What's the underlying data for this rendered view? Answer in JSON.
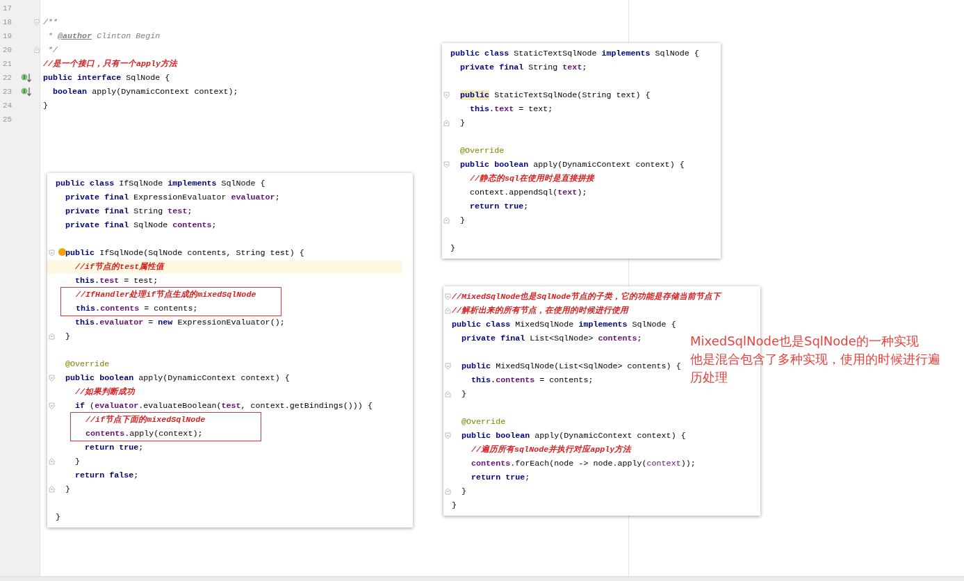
{
  "editor": {
    "lines": [
      {
        "number": "17",
        "kind": "blank",
        "gutter_icon": false
      },
      {
        "number": "18",
        "kind": "code",
        "gutter_icon": false,
        "fold_start": true,
        "tokens": [
          {
            "kind": "doc",
            "text": "/**"
          }
        ]
      },
      {
        "number": "19",
        "kind": "code",
        "gutter_icon": false,
        "tokens": [
          {
            "kind": "doc",
            "text": " * "
          },
          {
            "kind": "doctag",
            "text": "@author"
          },
          {
            "kind": "doc",
            "text": " Clinton Begin"
          }
        ]
      },
      {
        "number": "20",
        "kind": "code",
        "gutter_icon": false,
        "fold_end": true,
        "tokens": [
          {
            "kind": "doc",
            "text": " */"
          }
        ]
      },
      {
        "number": "21",
        "kind": "code",
        "gutter_icon": false,
        "tokens": [
          {
            "kind": "comment",
            "text": "//是一个接口，只有一个apply方法"
          }
        ]
      },
      {
        "number": "22",
        "kind": "code",
        "gutter_icon": true,
        "tokens": [
          {
            "kind": "keyword",
            "text": "public interface "
          },
          {
            "kind": "plain",
            "text": "SqlNode {"
          }
        ]
      },
      {
        "number": "23",
        "kind": "code",
        "gutter_icon": true,
        "tokens": [
          {
            "kind": "keyword",
            "text": "  boolean "
          },
          {
            "kind": "plain",
            "text": "apply(DynamicContext context);"
          }
        ]
      },
      {
        "number": "24",
        "kind": "code",
        "gutter_icon": false,
        "tokens": [
          {
            "kind": "plain",
            "text": "}"
          }
        ]
      },
      {
        "number": "25",
        "kind": "blank",
        "gutter_icon": false
      }
    ]
  },
  "panels": [
    {
      "lines": [
        {
          "kind": "code",
          "tokens": [
            {
              "kind": "keyword",
              "text": "public class "
            },
            {
              "kind": "plain",
              "text": "IfSqlNode "
            },
            {
              "kind": "keyword",
              "text": "implements "
            },
            {
              "kind": "plain",
              "text": "SqlNode {"
            }
          ]
        },
        {
          "kind": "code",
          "tokens": [
            {
              "kind": "keyword",
              "text": "  private final "
            },
            {
              "kind": "plain",
              "text": "ExpressionEvaluator "
            },
            {
              "kind": "field",
              "text": "evaluator"
            },
            {
              "kind": "plain",
              "text": ";"
            }
          ]
        },
        {
          "kind": "code",
          "tokens": [
            {
              "kind": "keyword",
              "text": "  private final "
            },
            {
              "kind": "plain",
              "text": "String "
            },
            {
              "kind": "field",
              "text": "test"
            },
            {
              "kind": "plain",
              "text": ";"
            }
          ]
        },
        {
          "kind": "code",
          "tokens": [
            {
              "kind": "keyword",
              "text": "  private final "
            },
            {
              "kind": "plain",
              "text": "SqlNode "
            },
            {
              "kind": "field",
              "text": "contents"
            },
            {
              "kind": "plain",
              "text": ";"
            }
          ]
        },
        {
          "kind": "blank"
        },
        {
          "kind": "code",
          "fold_start": true,
          "bulb": true,
          "tokens": [
            {
              "kind": "keyword",
              "text": "  public "
            },
            {
              "kind": "plain",
              "text": "IfSqlNode(SqlNode contents, String test) {"
            }
          ]
        },
        {
          "kind": "code",
          "highlighted": true,
          "tokens": [
            {
              "kind": "comment",
              "text": "    //if节点的test属性值"
            }
          ]
        },
        {
          "kind": "code",
          "tokens": [
            {
              "kind": "keyword",
              "text": "    this."
            },
            {
              "kind": "field",
              "text": "test"
            },
            {
              "kind": "plain",
              "text": " = test;"
            }
          ]
        },
        {
          "kind": "box",
          "lines": [
            {
              "kind": "code",
              "tokens": [
                {
                  "kind": "comment",
                  "text": "    //IfHandler处理if节点生成的mixedSqlNode"
                }
              ]
            },
            {
              "kind": "code",
              "tokens": [
                {
                  "kind": "keyword",
                  "text": "    this."
                },
                {
                  "kind": "field",
                  "text": "contents"
                },
                {
                  "kind": "plain",
                  "text": " = contents;"
                }
              ]
            }
          ]
        },
        {
          "kind": "code",
          "tokens": [
            {
              "kind": "keyword",
              "text": "    this."
            },
            {
              "kind": "field",
              "text": "evaluator"
            },
            {
              "kind": "plain",
              "text": " = "
            },
            {
              "kind": "keyword",
              "text": "new "
            },
            {
              "kind": "plain",
              "text": "ExpressionEvaluator();"
            }
          ]
        },
        {
          "kind": "code",
          "fold_end": true,
          "tokens": [
            {
              "kind": "plain",
              "text": "  }"
            }
          ]
        },
        {
          "kind": "blank"
        },
        {
          "kind": "code",
          "tokens": [
            {
              "kind": "annotation",
              "text": "  @Override"
            }
          ]
        },
        {
          "kind": "code",
          "fold_start": true,
          "tokens": [
            {
              "kind": "keyword",
              "text": "  public boolean "
            },
            {
              "kind": "plain",
              "text": "apply(DynamicContext context) {"
            }
          ]
        },
        {
          "kind": "code",
          "tokens": [
            {
              "kind": "comment",
              "text": "    //如果判断成功"
            }
          ]
        },
        {
          "kind": "code",
          "fold_start": true,
          "tokens": [
            {
              "kind": "keyword",
              "text": "    if "
            },
            {
              "kind": "plain",
              "text": "("
            },
            {
              "kind": "field",
              "text": "evaluator"
            },
            {
              "kind": "plain",
              "text": ".evaluateBoolean("
            },
            {
              "kind": "field",
              "text": "test"
            },
            {
              "kind": "plain",
              "text": ", context.getBindings())) {"
            }
          ]
        },
        {
          "kind": "box",
          "lines": [
            {
              "kind": "code",
              "tokens": [
                {
                  "kind": "comment",
                  "text": "      //if节点下面的mixedSqlNode"
                }
              ]
            },
            {
              "kind": "code",
              "tokens": [
                {
                  "kind": "field",
                  "text": "      contents"
                },
                {
                  "kind": "plain",
                  "text": ".apply(context);"
                }
              ]
            }
          ]
        },
        {
          "kind": "code",
          "tokens": [
            {
              "kind": "keyword",
              "text": "      return true"
            },
            {
              "kind": "plain",
              "text": ";"
            }
          ]
        },
        {
          "kind": "code",
          "fold_end": true,
          "tokens": [
            {
              "kind": "plain",
              "text": "    }"
            }
          ]
        },
        {
          "kind": "code",
          "tokens": [
            {
              "kind": "keyword",
              "text": "    return false"
            },
            {
              "kind": "plain",
              "text": ";"
            }
          ]
        },
        {
          "kind": "code",
          "fold_end": true,
          "tokens": [
            {
              "kind": "plain",
              "text": "  }"
            }
          ]
        },
        {
          "kind": "blank"
        },
        {
          "kind": "code",
          "tokens": [
            {
              "kind": "plain",
              "text": "}"
            }
          ]
        }
      ]
    },
    {
      "lines": [
        {
          "kind": "code",
          "tokens": [
            {
              "kind": "keyword",
              "text": "public class "
            },
            {
              "kind": "plain",
              "text": "StaticTextSqlNode "
            },
            {
              "kind": "keyword",
              "text": "implements "
            },
            {
              "kind": "plain",
              "text": "SqlNode {"
            }
          ]
        },
        {
          "kind": "code",
          "tokens": [
            {
              "kind": "keyword",
              "text": "  private final "
            },
            {
              "kind": "plain",
              "text": "String "
            },
            {
              "kind": "field",
              "text": "text"
            },
            {
              "kind": "plain",
              "text": ";"
            }
          ]
        },
        {
          "kind": "blank"
        },
        {
          "kind": "code",
          "fold_start": true,
          "tokens": [
            {
              "kind": "keyword_marked",
              "text": "  public"
            },
            {
              "kind": "plain",
              "text": " StaticTextSqlNode(String text) {"
            }
          ]
        },
        {
          "kind": "code",
          "tokens": [
            {
              "kind": "keyword",
              "text": "    this."
            },
            {
              "kind": "field",
              "text": "text"
            },
            {
              "kind": "plain",
              "text": " = text;"
            }
          ]
        },
        {
          "kind": "code",
          "fold_end": true,
          "tokens": [
            {
              "kind": "plain",
              "text": "  }"
            }
          ]
        },
        {
          "kind": "blank"
        },
        {
          "kind": "code",
          "tokens": [
            {
              "kind": "annotation",
              "text": "  @Override"
            }
          ]
        },
        {
          "kind": "code",
          "fold_start": true,
          "tokens": [
            {
              "kind": "keyword",
              "text": "  public boolean "
            },
            {
              "kind": "plain",
              "text": "apply(DynamicContext context) {"
            }
          ]
        },
        {
          "kind": "code",
          "tokens": [
            {
              "kind": "comment",
              "text": "    //静态的sql在使用时是直接拼接"
            }
          ]
        },
        {
          "kind": "code",
          "tokens": [
            {
              "kind": "plain",
              "text": "    context.appendSql("
            },
            {
              "kind": "field",
              "text": "text"
            },
            {
              "kind": "plain",
              "text": ");"
            }
          ]
        },
        {
          "kind": "code",
          "tokens": [
            {
              "kind": "keyword",
              "text": "    return true"
            },
            {
              "kind": "plain",
              "text": ";"
            }
          ]
        },
        {
          "kind": "code",
          "fold_end": true,
          "tokens": [
            {
              "kind": "plain",
              "text": "  }"
            }
          ]
        },
        {
          "kind": "blank"
        },
        {
          "kind": "code",
          "tokens": [
            {
              "kind": "plain",
              "text": "}"
            }
          ]
        }
      ]
    },
    {
      "lines": [
        {
          "kind": "code",
          "fold_start": true,
          "tokens": [
            {
              "kind": "comment",
              "text": "//MixedSqlNode也是SqlNode节点的子类，它的功能是存储当前节点下"
            }
          ]
        },
        {
          "kind": "code",
          "fold_end": true,
          "tokens": [
            {
              "kind": "comment",
              "text": "//解析出来的所有节点，在使用的时候进行使用"
            }
          ]
        },
        {
          "kind": "code",
          "tokens": [
            {
              "kind": "keyword",
              "text": "public class "
            },
            {
              "kind": "plain",
              "text": "MixedSqlNode "
            },
            {
              "kind": "keyword",
              "text": "implements "
            },
            {
              "kind": "plain",
              "text": "SqlNode {"
            }
          ]
        },
        {
          "kind": "code",
          "tokens": [
            {
              "kind": "keyword",
              "text": "  private final "
            },
            {
              "kind": "plain",
              "text": "List<SqlNode> "
            },
            {
              "kind": "field",
              "text": "contents"
            },
            {
              "kind": "plain",
              "text": ";"
            }
          ]
        },
        {
          "kind": "blank"
        },
        {
          "kind": "code",
          "fold_start": true,
          "tokens": [
            {
              "kind": "keyword",
              "text": "  public "
            },
            {
              "kind": "plain",
              "text": "MixedSqlNode(List<SqlNode> contents) {"
            }
          ]
        },
        {
          "kind": "code",
          "tokens": [
            {
              "kind": "keyword",
              "text": "    this."
            },
            {
              "kind": "field",
              "text": "contents"
            },
            {
              "kind": "plain",
              "text": " = contents;"
            }
          ]
        },
        {
          "kind": "code",
          "fold_end": true,
          "tokens": [
            {
              "kind": "plain",
              "text": "  }"
            }
          ]
        },
        {
          "kind": "blank"
        },
        {
          "kind": "code",
          "tokens": [
            {
              "kind": "annotation",
              "text": "  @Override"
            }
          ]
        },
        {
          "kind": "code",
          "fold_start": true,
          "tokens": [
            {
              "kind": "keyword",
              "text": "  public boolean "
            },
            {
              "kind": "plain",
              "text": "apply(DynamicContext context) {"
            }
          ]
        },
        {
          "kind": "code",
          "tokens": [
            {
              "kind": "comment",
              "text": "    //遍历所有sqlNode并执行对应apply方法"
            }
          ]
        },
        {
          "kind": "code",
          "tokens": [
            {
              "kind": "field",
              "text": "    contents"
            },
            {
              "kind": "plain",
              "text": ".forEach(node -> node.apply("
            },
            {
              "kind": "param",
              "text": "context"
            },
            {
              "kind": "plain",
              "text": "));"
            }
          ]
        },
        {
          "kind": "code",
          "tokens": [
            {
              "kind": "keyword",
              "text": "    return true"
            },
            {
              "kind": "plain",
              "text": ";"
            }
          ]
        },
        {
          "kind": "code",
          "fold_end": true,
          "tokens": [
            {
              "kind": "plain",
              "text": "  }"
            }
          ]
        },
        {
          "kind": "code",
          "tokens": [
            {
              "kind": "plain",
              "text": "}"
            }
          ]
        }
      ]
    }
  ],
  "note": {
    "lines": [
      "MixedSqlNode也是SqlNode的一种实现",
      "他是混合包含了多种实现，使用的时候进行遍",
      "历处理"
    ]
  }
}
